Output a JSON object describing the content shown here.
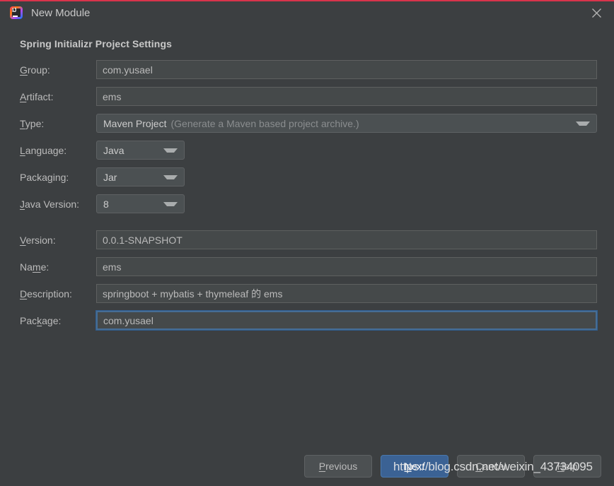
{
  "window": {
    "title": "New Module",
    "icon": "intellij-idea-icon",
    "close_icon": "close-icon",
    "accent_border": "#d9344b"
  },
  "section": {
    "heading": "Spring Initializr Project Settings"
  },
  "fields": {
    "group": {
      "label_pre": "",
      "label_mnemonic": "G",
      "label_post": "roup:",
      "value": "com.yusael"
    },
    "artifact": {
      "label_pre": "",
      "label_mnemonic": "A",
      "label_post": "rtifact:",
      "value": "ems"
    },
    "type": {
      "label_pre": "",
      "label_mnemonic": "T",
      "label_post": "ype:",
      "value": "Maven Project",
      "hint": "(Generate a Maven based project archive.)"
    },
    "language": {
      "label_pre": "",
      "label_mnemonic": "L",
      "label_post": "anguage:",
      "value": "Java"
    },
    "packaging": {
      "label_pre": "Packa",
      "label_mnemonic": "g",
      "label_post": "ing:",
      "value": "Jar"
    },
    "java_version": {
      "label_pre": "",
      "label_mnemonic": "J",
      "label_post": "ava Version:",
      "value": "8"
    },
    "version": {
      "label_pre": "",
      "label_mnemonic": "V",
      "label_post": "ersion:",
      "value": "0.0.1-SNAPSHOT"
    },
    "name": {
      "label_pre": "Na",
      "label_mnemonic": "m",
      "label_post": "e:",
      "value": "ems"
    },
    "description": {
      "label_pre": "",
      "label_mnemonic": "D",
      "label_post": "escription:",
      "value": "springboot + mybatis + thymeleaf 的 ems"
    },
    "package": {
      "label_pre": "Pac",
      "label_mnemonic": "k",
      "label_post": "age:",
      "value": "com.yusael",
      "focused": true,
      "focus_color": "#466d94"
    }
  },
  "footer": {
    "previous": {
      "pre": "",
      "mnemonic": "P",
      "post": "revious"
    },
    "next": {
      "pre": "",
      "mnemonic": "N",
      "post": "ext",
      "primary": true,
      "color": "#3b6294"
    },
    "cancel": {
      "pre": "",
      "mnemonic": "C",
      "post": "ancel"
    },
    "help": {
      "pre": "",
      "mnemonic": "H",
      "post": "elp"
    }
  },
  "watermark": {
    "text": "https://blog.csdn.net/weixin_43734095"
  }
}
